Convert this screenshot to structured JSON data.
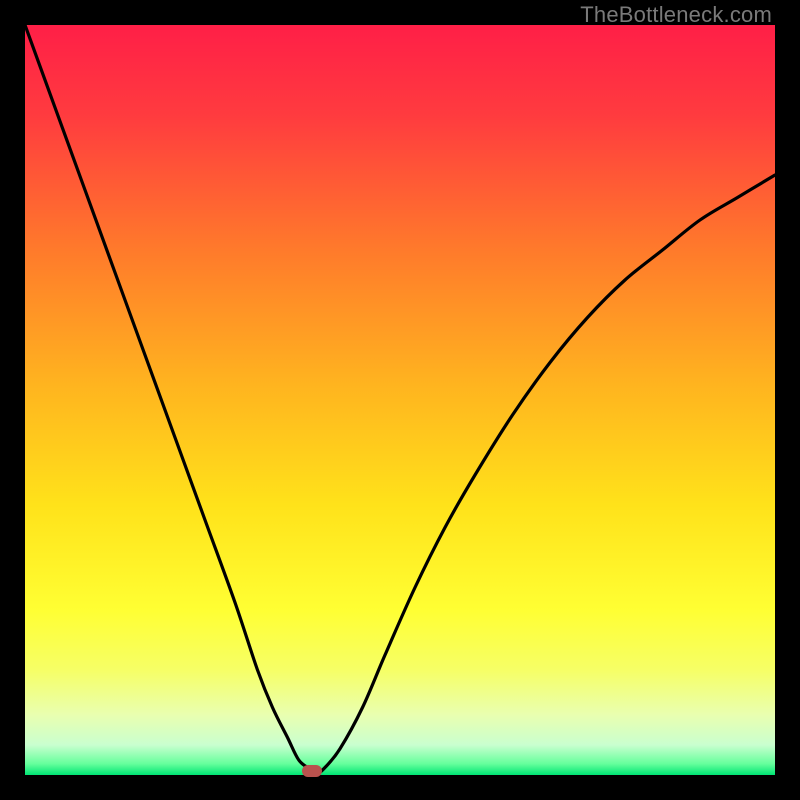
{
  "watermark": "TheBottleneck.com",
  "gradient": {
    "stops": [
      {
        "offset": 0.0,
        "color": "#ff1f47"
      },
      {
        "offset": 0.12,
        "color": "#ff3b3f"
      },
      {
        "offset": 0.3,
        "color": "#ff7a2b"
      },
      {
        "offset": 0.48,
        "color": "#ffb41f"
      },
      {
        "offset": 0.64,
        "color": "#ffe21a"
      },
      {
        "offset": 0.78,
        "color": "#ffff33"
      },
      {
        "offset": 0.86,
        "color": "#f6ff66"
      },
      {
        "offset": 0.92,
        "color": "#e9ffb0"
      },
      {
        "offset": 0.96,
        "color": "#c9ffcf"
      },
      {
        "offset": 0.985,
        "color": "#66ff9c"
      },
      {
        "offset": 1.0,
        "color": "#00e574"
      }
    ]
  },
  "chart_data": {
    "type": "line",
    "title": "",
    "xlabel": "",
    "ylabel": "",
    "xlim": [
      0,
      100
    ],
    "ylim": [
      0,
      100
    ],
    "series": [
      {
        "name": "bottleneck-curve",
        "x": [
          0,
          4,
          8,
          12,
          16,
          20,
          24,
          28,
          31,
          33,
          35,
          36.5,
          38,
          39,
          40,
          42,
          45,
          48,
          52,
          56,
          60,
          65,
          70,
          75,
          80,
          85,
          90,
          95,
          100
        ],
        "y": [
          100,
          89,
          78,
          67,
          56,
          45,
          34,
          23,
          14,
          9,
          5,
          2,
          0.8,
          0.3,
          1.0,
          3.5,
          9,
          16,
          25,
          33,
          40,
          48,
          55,
          61,
          66,
          70,
          74,
          77,
          80
        ]
      }
    ],
    "marker": {
      "x": 38.3,
      "y": 0.5,
      "color": "#b9524e"
    }
  }
}
